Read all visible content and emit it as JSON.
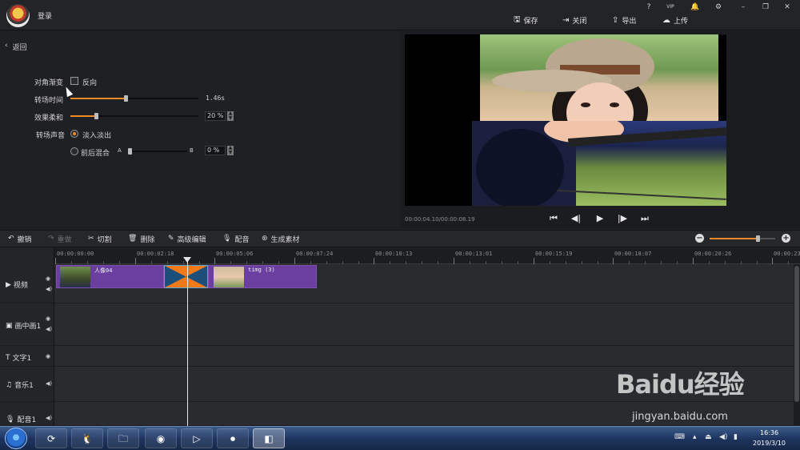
{
  "titlebar": {
    "login": "登录",
    "window_icons": [
      "?",
      "VIP",
      "🔔",
      "⚙",
      "–",
      "❐",
      "✕"
    ],
    "actions": [
      {
        "icon": "save-icon",
        "glyph": "🖫",
        "label": "保存"
      },
      {
        "icon": "close-doc-icon",
        "glyph": "⇥",
        "label": "关闭"
      },
      {
        "icon": "export-icon",
        "glyph": "⇪",
        "label": "导出"
      },
      {
        "icon": "upload-icon",
        "glyph": "☁",
        "label": "上传"
      }
    ]
  },
  "left": {
    "back": "返回",
    "diagonal_label": "对角渐变",
    "reverse_label": "反向",
    "duration_label": "转场时间",
    "duration_value": "1.46s",
    "duration_level": 0.43,
    "softness_label": "效果柔和",
    "softness_value": "20 %",
    "softness_level": 0.2,
    "audio_label": "转场声音",
    "fade_label": "淡入淡出",
    "mix_label": "前后混合",
    "mix_a": "A",
    "mix_b": "B",
    "mix_value": "0 %",
    "mix_level": 0.0
  },
  "preview": {
    "timecode": "00:00:04.10/00:00:08.19"
  },
  "toolbar": {
    "undo": "撤销",
    "redo": "重做",
    "cut": "切割",
    "delete": "删除",
    "advanced": "高级编辑",
    "dub": "配音",
    "generate": "生成素材",
    "zoom_level": 0.73
  },
  "ruler": {
    "ticks": [
      "00:00:00:00",
      "00:00:02:18",
      "00:00:05:06",
      "00:00:07:24",
      "00:00:10:13",
      "00:00:13:01",
      "00:00:15:19",
      "00:00:18:07",
      "00:00:20:26",
      "00:00:23:"
    ]
  },
  "tracks": [
    {
      "label": "视频",
      "icon": "video-icon",
      "glyph": "▶"
    },
    {
      "label": "画中画1",
      "icon": "pip-icon",
      "glyph": "▣"
    },
    {
      "label": "文字1",
      "icon": "text-icon",
      "glyph": "T"
    },
    {
      "label": "音乐1",
      "icon": "music-icon",
      "glyph": "♫"
    },
    {
      "label": "配音1",
      "icon": "mic-icon",
      "glyph": "🎙"
    }
  ],
  "clips": [
    {
      "label": "人像04"
    },
    {
      "label": "timg (3)"
    }
  ],
  "taskbar": {
    "time": "16:36",
    "date": "2019/3/10"
  },
  "watermark": {
    "logo": "Baidu经验",
    "url": "jingyan.baidu.com"
  },
  "colors": {
    "accent": "#f08a26",
    "clip": "#6a3fa0",
    "background": "#1e1f21"
  }
}
